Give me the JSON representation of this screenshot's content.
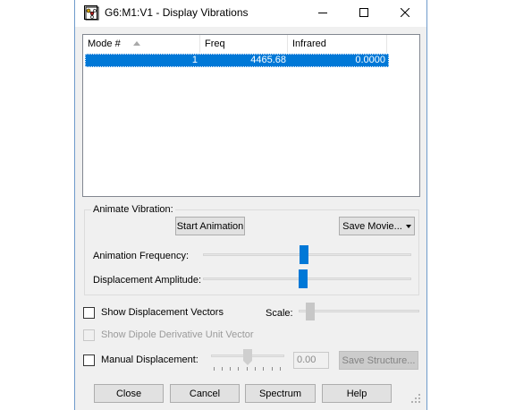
{
  "window": {
    "title": "G6:M1:V1 - Display Vibrations",
    "icon": "gaussview-molecule-icon"
  },
  "caption_buttons": {
    "minimize": "minimize-icon",
    "maximize": "maximize-icon",
    "close": "close-icon"
  },
  "table": {
    "columns": [
      "Mode #",
      "Freq",
      "Infrared"
    ],
    "sort_column": "Mode #",
    "rows": [
      {
        "mode": "1",
        "freq": "4465.68",
        "infrared": "0.0000",
        "selected": true
      }
    ]
  },
  "animate": {
    "group_label": "Animate Vibration:",
    "start_button": "Start Animation",
    "save_movie_button": "Save Movie...",
    "frequency_label": "Animation Frequency:",
    "frequency_level": 0.5,
    "amplitude_label": "Displacement Amplitude:",
    "amplitude_level": 0.49
  },
  "options": {
    "show_displacement_vectors": {
      "label": "Show Displacement Vectors",
      "checked": false
    },
    "scale_label": "Scale:",
    "show_dipole": {
      "label": "Show Dipole Derivative Unit Vector",
      "checked": false,
      "enabled": false
    },
    "manual_displacement": {
      "label": "Manual Displacement:",
      "checked": false
    },
    "manual_value": "0.00",
    "save_structure_button": "Save Structure..."
  },
  "footer": {
    "close": "Close",
    "cancel": "Cancel",
    "spectrum": "Spectrum",
    "help": "Help"
  },
  "colors": {
    "selection": "#0078d7",
    "slider_thumb": "#0078d7"
  }
}
